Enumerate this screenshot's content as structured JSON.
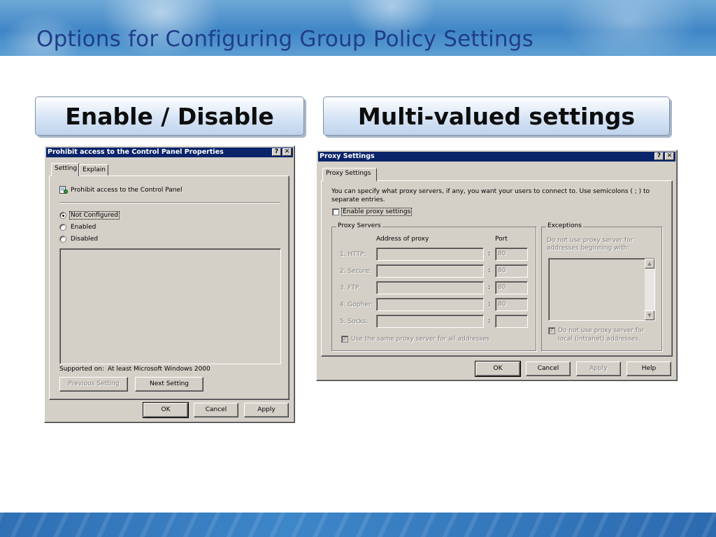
{
  "slide": {
    "title": "Options for Configuring Group Policy Settings",
    "sections": {
      "left_label": "Enable / Disable",
      "right_label": "Multi-valued settings"
    }
  },
  "policy_dialog": {
    "title": "Prohibit access to the Control Panel Properties",
    "help_button": "?",
    "close_button": "✕",
    "tabs": [
      "Setting",
      "Explain"
    ],
    "policy_name": "Prohibit access to the Control Panel",
    "icon": "policy-setting-icon",
    "options": [
      {
        "label": "Not Configured",
        "checked": true
      },
      {
        "label": "Enabled",
        "checked": false
      },
      {
        "label": "Disabled",
        "checked": false
      }
    ],
    "supported_on_label": "Supported on:",
    "supported_on_value": "At least Microsoft Windows 2000",
    "previous_setting": "Previous Setting",
    "next_setting": "Next Setting",
    "ok": "OK",
    "cancel": "Cancel",
    "apply": "Apply"
  },
  "proxy_dialog": {
    "title": "Proxy Settings",
    "help_button": "?",
    "close_button": "✕",
    "tab": "Proxy Settings",
    "description_line1": "You can specify what proxy servers, if any, you want your users to connect to. Use semicolons ( ; ) to",
    "description_line2": "separate entries.",
    "enable_proxy_label": "Enable proxy settings",
    "proxy_servers_group": "Proxy Servers",
    "address_header": "Address of proxy",
    "port_header": "Port",
    "rows": [
      {
        "label": "1. HTTP:",
        "address": "",
        "port": "80"
      },
      {
        "label": "2. Secure:",
        "address": "",
        "port": "80"
      },
      {
        "label": "3. FTP:",
        "address": "",
        "port": "80"
      },
      {
        "label": "4. Gopher:",
        "address": "",
        "port": "80"
      },
      {
        "label": "5. Socks:",
        "address": "",
        "port": ""
      }
    ],
    "colon": ":",
    "same_proxy_label": "Use the same proxy server for all addresses",
    "exceptions_group": "Exceptions",
    "exceptions_text_line1": "Do not use proxy server for",
    "exceptions_text_line2": "addresses beginning with:",
    "local_bypass_line1": "Do not use proxy server for",
    "local_bypass_line2": "local (intranet) addresses.",
    "ok": "OK",
    "cancel": "Cancel",
    "apply": "Apply",
    "help": "Help"
  },
  "colors": {
    "title_text": "#1f3e8a",
    "titlebar": "#0a246a",
    "dialog_face": "#d4d0c8"
  }
}
